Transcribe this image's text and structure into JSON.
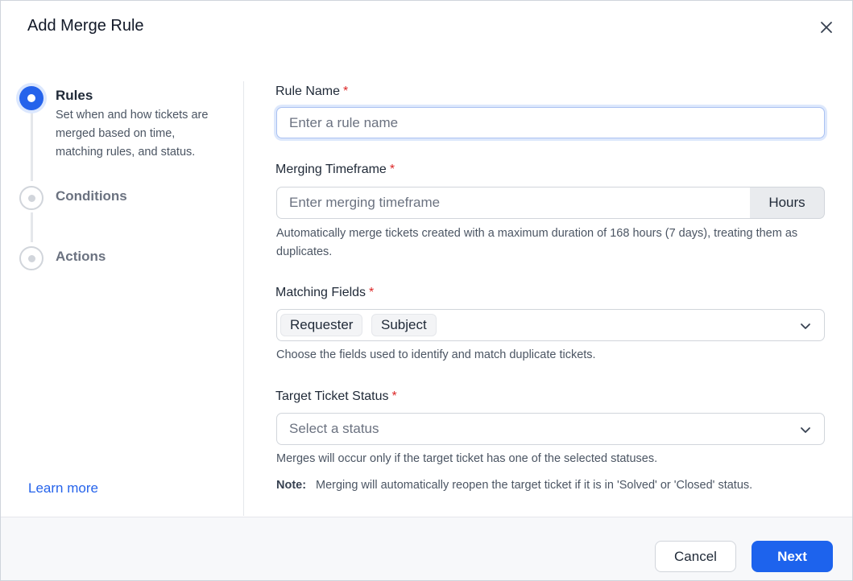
{
  "dialog": {
    "title": "Add Merge Rule",
    "close_icon": "close-icon"
  },
  "stepper": {
    "steps": [
      {
        "title": "Rules",
        "description": "Set when and how tickets are merged based on time, matching rules, and status.",
        "state": "active"
      },
      {
        "title": "Conditions",
        "state": "inactive"
      },
      {
        "title": "Actions",
        "state": "inactive"
      }
    ],
    "learn_more": "Learn more"
  },
  "form": {
    "required_marker": "*",
    "rule_name": {
      "label": "Rule Name",
      "placeholder": "Enter a rule name",
      "value": ""
    },
    "merging_timeframe": {
      "label": "Merging Timeframe",
      "placeholder": "Enter merging timeframe",
      "value": "",
      "suffix": "Hours",
      "help": "Automatically merge tickets created with a maximum duration of 168 hours (7 days), treating them as duplicates."
    },
    "matching_fields": {
      "label": "Matching Fields",
      "selected": [
        "Requester",
        "Subject"
      ],
      "help": "Choose the fields used to identify and match duplicate tickets."
    },
    "target_ticket_status": {
      "label": "Target Ticket Status",
      "placeholder": "Select a status",
      "help": "Merges will occur only if the target ticket has one of the selected statuses.",
      "note_label": "Note:",
      "note_text": "Merging will automatically reopen the target ticket if it is in 'Solved' or 'Closed' status."
    }
  },
  "footer": {
    "cancel_label": "Cancel",
    "next_label": "Next"
  },
  "colors": {
    "primary": "#1d63ed",
    "required": "#dc2626",
    "link": "#2563eb"
  }
}
